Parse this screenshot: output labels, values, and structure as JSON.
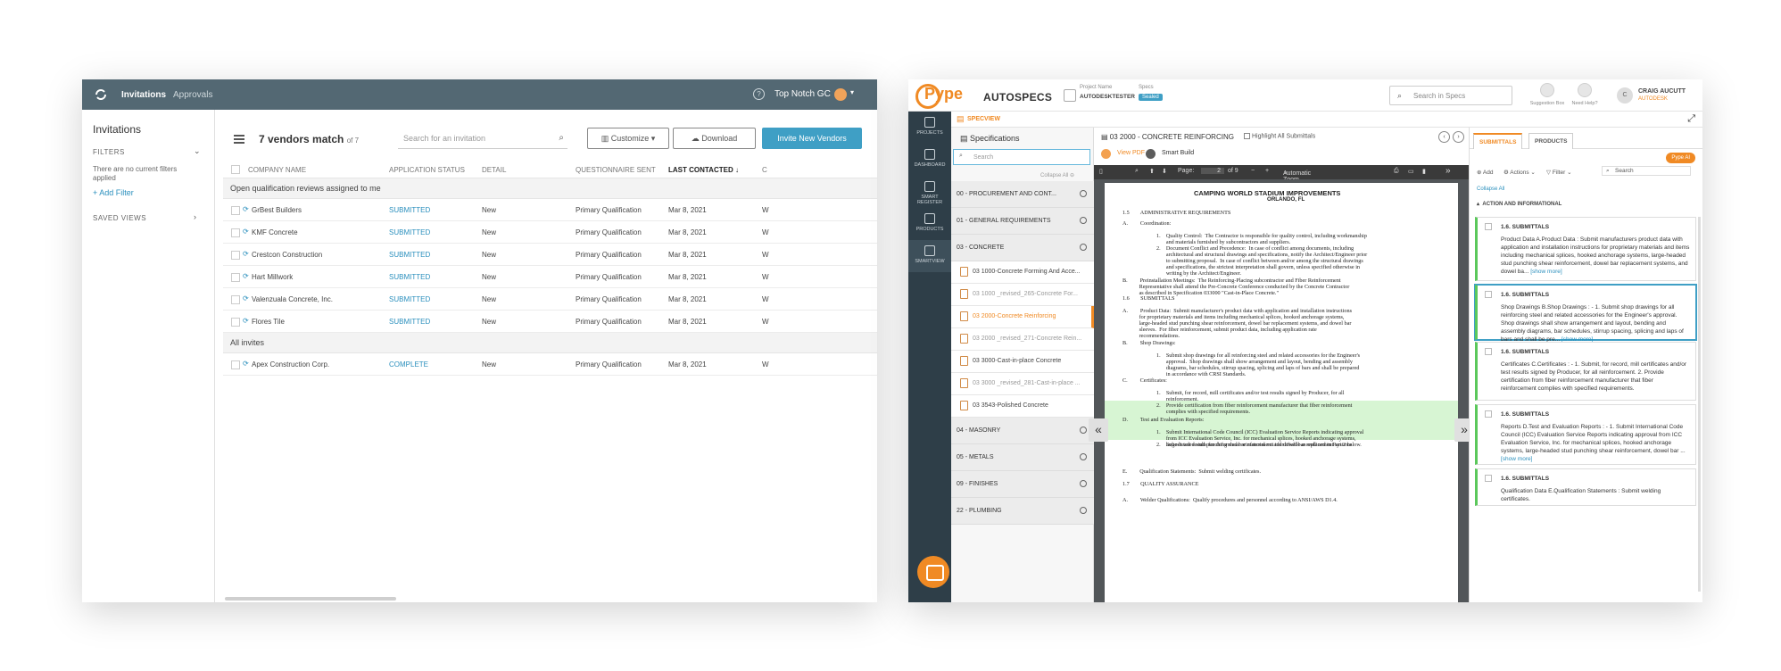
{
  "left": {
    "topbar": {
      "nav_invitations": "Invitations",
      "nav_approvals": "Approvals",
      "help": "?",
      "org": "Top Notch GC"
    },
    "sidebar": {
      "title": "Invitations",
      "filters_label": "FILTERS",
      "filters_note": "There are no current filters applied",
      "add_filter": "+ Add Filter",
      "saved_views_label": "SAVED VIEWS"
    },
    "toolbar": {
      "count_title": "7 vendors match",
      "count_of": "of 7",
      "search_placeholder": "Search for an invitation",
      "customize": "Customize",
      "download": "Download",
      "invite": "Invite New Vendors"
    },
    "columns": [
      "COMPANY NAME",
      "APPLICATION STATUS",
      "DETAIL",
      "QUESTIONNAIRE SENT",
      "LAST CONTACTED ↓",
      "C"
    ],
    "groups": [
      {
        "title": "Open qualification reviews assigned to me",
        "rows": [
          {
            "company": "GrBest Builders",
            "status": "SUBMITTED",
            "detail": "New",
            "q": "Primary Qualification",
            "date": "Mar 8, 2021",
            "c": "W"
          },
          {
            "company": "KMF Concrete",
            "status": "SUBMITTED",
            "detail": "New",
            "q": "Primary Qualification",
            "date": "Mar 8, 2021",
            "c": "W"
          },
          {
            "company": "Crestcon Construction",
            "status": "SUBMITTED",
            "detail": "New",
            "q": "Primary Qualification",
            "date": "Mar 8, 2021",
            "c": "W"
          },
          {
            "company": "Hart Millwork",
            "status": "SUBMITTED",
            "detail": "New",
            "q": "Primary Qualification",
            "date": "Mar 8, 2021",
            "c": "W"
          },
          {
            "company": "Valenzuala Concrete, Inc.",
            "status": "SUBMITTED",
            "detail": "New",
            "q": "Primary Qualification",
            "date": "Mar 8, 2021",
            "c": "W"
          },
          {
            "company": "Flores Tile",
            "status": "SUBMITTED",
            "detail": "New",
            "q": "Primary Qualification",
            "date": "Mar 8, 2021",
            "c": "W"
          }
        ]
      },
      {
        "title": "All invites",
        "rows": [
          {
            "company": "Apex Construction Corp.",
            "status": "COMPLETE",
            "detail": "New",
            "q": "Primary Qualification",
            "date": "Mar 8, 2021",
            "c": "W"
          }
        ]
      }
    ]
  },
  "right": {
    "header": {
      "logo": "Pype",
      "app": "AUTOSPECS",
      "project_label": "Project Name",
      "project_value": "AUTODESKTESTER",
      "specs_label": "Specs",
      "specs_badge": "Sealed",
      "search_placeholder": "Search in Specs",
      "suggestion": "Suggestion Box",
      "help": "Need Help?",
      "user_initial": "C",
      "user_name": "CRAIG AUCUTT",
      "user_org": "AUTODESK"
    },
    "nav": [
      "PROJECTS",
      "DASHBOARD",
      "SMART REGISTER",
      "PRODUCTS",
      "SMARTVIEW"
    ],
    "specview_label": "SPECVIEW",
    "specs": {
      "title": "Specifications",
      "search_placeholder": "Search",
      "collapse_all": "Collapse All",
      "items": [
        {
          "type": "cat",
          "label": "00 - PROCUREMENT AND CONT..."
        },
        {
          "type": "cat",
          "label": "01 - GENERAL REQUIREMENTS"
        },
        {
          "type": "cat",
          "label": "03 - CONCRETE"
        },
        {
          "type": "doc",
          "label": "03 1000-Concrete Forming And Acce..."
        },
        {
          "type": "grey",
          "label": "03 1000 _revised_265-Concrete For..."
        },
        {
          "type": "sel",
          "label": "03 2000-Concrete Reinforcing"
        },
        {
          "type": "grey",
          "label": "03 2000 _revised_271-Concrete Rein..."
        },
        {
          "type": "doc",
          "label": "03 3000-Cast-in-place Concrete"
        },
        {
          "type": "grey",
          "label": "03 3000 _revised_281-Cast-in-place ..."
        },
        {
          "type": "doc",
          "label": "03 3543-Polished Concrete"
        },
        {
          "type": "cat",
          "label": "04 - MASONRY"
        },
        {
          "type": "cat",
          "label": "05 - METALS"
        },
        {
          "type": "cat",
          "label": "09 - FINISHES"
        },
        {
          "type": "cat",
          "label": "22 - PLUMBING"
        }
      ]
    },
    "doc": {
      "title": "03 2000 - CONCRETE REINFORCING",
      "highlight_all": "Highlight All Submittals",
      "view_pdf": "View PDF",
      "smart_build": "Smart Build",
      "page_label": "Page:",
      "page_value": "2",
      "page_of": "of 9",
      "zoom": "Automatic Zoom",
      "page_lines": [
        "CAMPING WORLD STADIUM IMPROVEMENTS",
        "ORLANDO, FL",
        "1.5        ADMINISTRATIVE REQUIREMENTS",
        "A.         Coordination:",
        "1.    Quality Control:  The Contractor is responsible for quality control, including workmanship\n       and materials furnished by subcontractors and suppliers.",
        "2.    Document Conflict and Precedence:  In case of conflict among documents, including\n       architectural and structural drawings and specifications, notify the Architect/Engineer prior\n       to submitting proposal.  In case of conflict between and/or among the structural drawings\n       and specifications, the strictest interpretation shall govern, unless specified otherwise in\n       writing by the Architect/Engineer.",
        "B.         Preinstallation Meetings:  The Reinforcing-Placing subcontractor and Fiber Reinforcement\n            Representative shall attend the Pre-Concrete Conference conducted by the Concrete Contractor\n            as described in Specification 033000 \"Cast-in-Place Concrete.\"",
        "1.6        SUBMITTALS",
        "A.         Product Data:  Submit manufacturer's product data with application and installation instructions\n            for proprietary materials and items including mechanical splices, hooked anchorage systems,\n            large-headed stud punching shear reinforcement, dowel bar replacement systems, and dowel bar\n            sleeves.  For fiber reinforcement, submit product data, including application rate\n            recommendations.",
        "B.         Shop Drawings:",
        "1.    Submit shop drawings for all reinforcing steel and related accessories for the Engineer's\n       approval.  Shop drawings shall show arrangement and layout, bending and assembly\n       diagrams, bar schedules, stirrup spacing, splicing and laps of bars and shall be prepared\n       in accordance with CRSI Standards.",
        "C.         Certificates:",
        "1.    Submit, for record, mill certificates and/or test results signed by Producer, for all\n       reinforcement.",
        "2.    Provide certification from fiber reinforcement manufacturer that fiber reinforcement\n       complies with specified requirements.",
        "D.         Test and Evaluation Reports:",
        "1.    Submit International Code Council (ICC) Evaluation Service Reports indicating approval\n       from ICC Evaluation Service, Inc. for mechanical splices, hooked anchorage systems,\n       large-headed stud punching shear reinforcement and dowel bar replacement systems.",
        "2.    Submit test results for deformed bar material not identifiable as outlined in Part 2 below.",
        "E.         Qualification Statements:  Submit welding certificates.",
        "1.7        QUALITY ASSURANCE",
        "A.         Welder Qualifications:  Qualify procedures and personnel according to ANSI/AWS D1.4."
      ]
    },
    "submittals": {
      "tab_submittals": "SUBMITTALS",
      "tab_products": "PRODUCTS",
      "pype_ai": "Pype AI",
      "add": "Add",
      "actions": "Actions",
      "filter": "Filter",
      "search_placeholder": "Search",
      "collapse_all": "Collapse All",
      "group": "ACTION AND INFORMATIONAL",
      "cards": [
        {
          "title": "1.6. SUBMITTALS",
          "body": "Product Data A.Product Data : Submit manufacturers product data with application and installation instructions for proprietary materials and items including mechanical splices, hooked anchorage systems, large-headed stud punching shear reinforcement, dowel bar replacement systems, and dowel ba...",
          "more": "[show more]"
        },
        {
          "title": "1.6. SUBMITTALS",
          "body": "Shop Drawings B.Shop Drawings : - 1. Submit shop drawings for all reinforcing steel and related accessories for the Engineer's approval. Shop drawings shall show arrangement and layout, bending and assembly diagrams, bar schedules, stirrup spacing, splicing and laps of bars and shall be pre...",
          "more": "[show more]"
        },
        {
          "title": "1.6. SUBMITTALS",
          "body": "Certificates C.Certificates : - 1. Submit, for record, mill certificates and/or test results signed by Producer, for all reinforcement. 2. Provide certification from fiber reinforcement manufacturer that fiber reinforcement complies with specified requirements.",
          "more": ""
        },
        {
          "title": "1.6. SUBMITTALS",
          "body": "Reports D.Test and Evaluation Reports : - 1. Submit International Code Council (ICC) Evaluation Service Reports indicating approval from ICC Evaluation Service, Inc. for mechanical splices, hooked anchorage systems, large-headed stud punching shear reinforcement, dowel bar ...",
          "more": "[show more]"
        },
        {
          "title": "1.6. SUBMITTALS",
          "body": "Qualification Data E.Qualification Statements : Submit welding certificates.",
          "more": ""
        }
      ]
    }
  }
}
